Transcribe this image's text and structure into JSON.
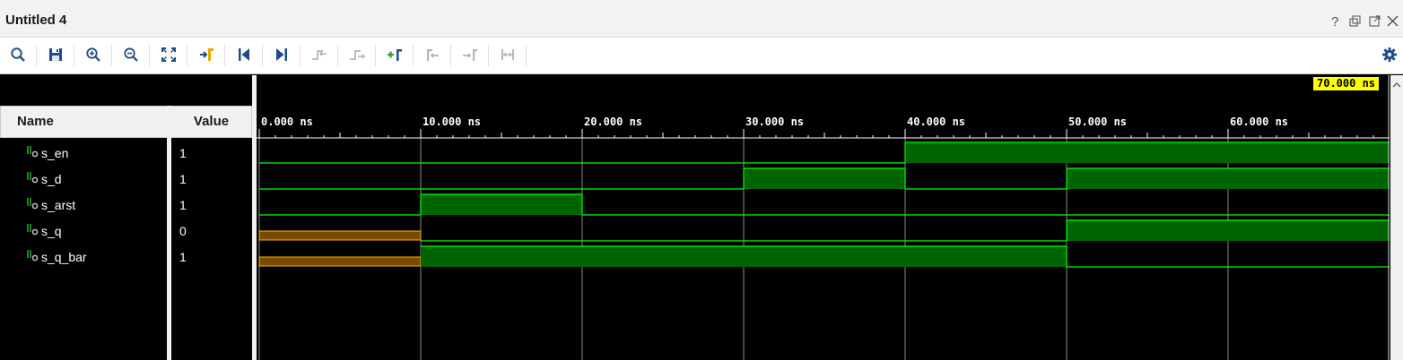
{
  "window": {
    "title": "Untitled 4",
    "controls": [
      {
        "name": "help-icon",
        "glyph": "?"
      },
      {
        "name": "restore-icon",
        "glyph": "⧉"
      },
      {
        "name": "float-icon",
        "glyph": "⬚"
      },
      {
        "name": "close-icon",
        "glyph": "✕"
      }
    ]
  },
  "toolbar": {
    "buttons": [
      {
        "name": "search-icon",
        "enabled": true
      },
      {
        "name": "save-icon",
        "enabled": true
      },
      {
        "name": "zoom-in-icon",
        "enabled": true
      },
      {
        "name": "zoom-out-icon",
        "enabled": true
      },
      {
        "name": "zoom-fit-icon",
        "enabled": true
      },
      {
        "name": "go-to-cursor-icon",
        "enabled": true
      },
      {
        "name": "go-to-time-zero-icon",
        "enabled": true
      },
      {
        "name": "go-to-last-time-icon",
        "enabled": true
      },
      {
        "name": "previous-transition-icon",
        "enabled": false
      },
      {
        "name": "next-transition-icon",
        "enabled": false
      },
      {
        "name": "add-marker-icon",
        "enabled": true
      },
      {
        "name": "previous-marker-icon",
        "enabled": false
      },
      {
        "name": "next-marker-icon",
        "enabled": false
      },
      {
        "name": "swap-cursors-icon",
        "enabled": false
      }
    ],
    "settings": "gear-icon"
  },
  "columns": {
    "name": "Name",
    "value": "Value"
  },
  "signals": [
    {
      "name": "s_en",
      "value": "1"
    },
    {
      "name": "s_d",
      "value": "1"
    },
    {
      "name": "s_arst",
      "value": "1"
    },
    {
      "name": "s_q",
      "value": "0"
    },
    {
      "name": "s_q_bar",
      "value": "1"
    }
  ],
  "timeline": {
    "unit": "ns",
    "ticks": [
      "0.000 ns",
      "10.000 ns",
      "20.000 ns",
      "30.000 ns",
      "40.000 ns",
      "50.000 ns",
      "60.000 ns"
    ],
    "cursor_label": "70.000 ns",
    "range_ns": [
      0,
      70
    ]
  },
  "waveforms": [
    {
      "signal": "s_en",
      "segments": [
        {
          "from": 0,
          "to": 40,
          "v": "0"
        },
        {
          "from": 40,
          "to": 70,
          "v": "1"
        }
      ]
    },
    {
      "signal": "s_d",
      "segments": [
        {
          "from": 0,
          "to": 30,
          "v": "0"
        },
        {
          "from": 30,
          "to": 40,
          "v": "1"
        },
        {
          "from": 40,
          "to": 50,
          "v": "0"
        },
        {
          "from": 50,
          "to": 70,
          "v": "1"
        }
      ]
    },
    {
      "signal": "s_arst",
      "segments": [
        {
          "from": 0,
          "to": 10,
          "v": "0"
        },
        {
          "from": 10,
          "to": 20,
          "v": "1"
        },
        {
          "from": 20,
          "to": 70,
          "v": "0"
        }
      ]
    },
    {
      "signal": "s_q",
      "segments": [
        {
          "from": 0,
          "to": 10,
          "v": "X"
        },
        {
          "from": 10,
          "to": 50,
          "v": "0"
        },
        {
          "from": 50,
          "to": 70,
          "v": "1"
        }
      ]
    },
    {
      "signal": "s_q_bar",
      "segments": [
        {
          "from": 0,
          "to": 10,
          "v": "X"
        },
        {
          "from": 10,
          "to": 50,
          "v": "1"
        },
        {
          "from": 50,
          "to": 70,
          "v": "0"
        }
      ]
    }
  ],
  "colors": {
    "wave_line": "#00ff00",
    "wave_high_fill": "#006400",
    "unknown_line": "#ffb000",
    "unknown_fill": "#7a4a00",
    "gridline": "#8a8a8a",
    "cursor_label_bg": "#ffff00"
  }
}
